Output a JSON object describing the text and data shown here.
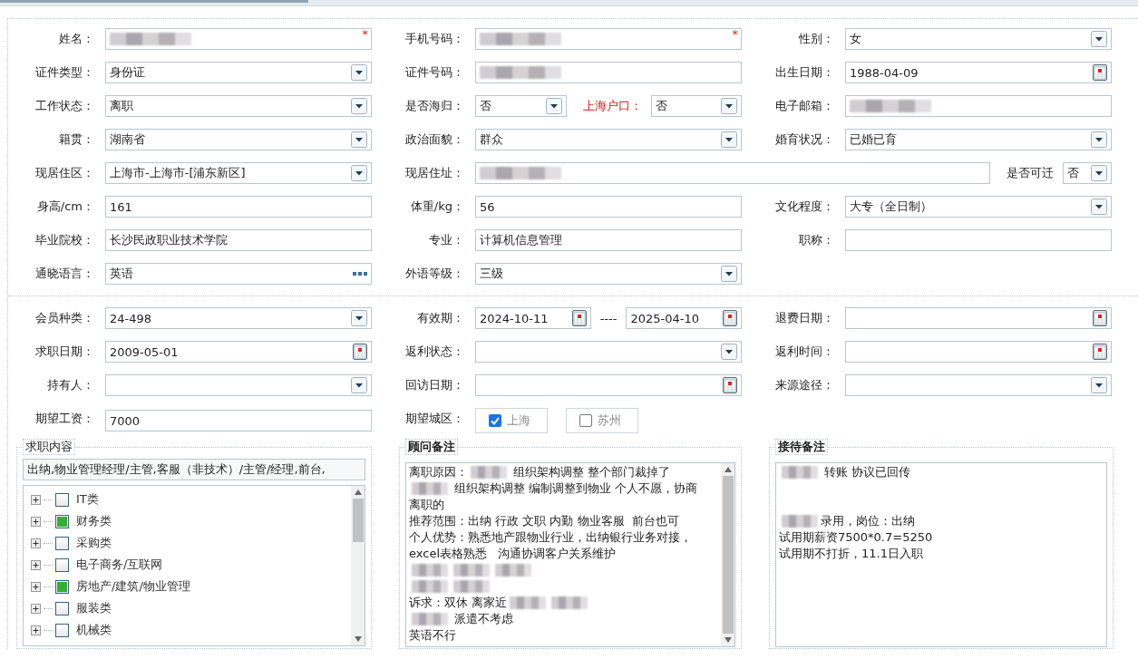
{
  "sections": [
    {
      "rows": [
        {
          "cells": [
            {
              "label": "姓名：",
              "fields": [
                {
                  "kind": "text",
                  "redacted": true,
                  "marker": "*"
                }
              ]
            },
            {
              "label": "手机号码：",
              "fields": [
                {
                  "kind": "text",
                  "redacted": true,
                  "marker": "*"
                }
              ]
            },
            {
              "label": "性别：",
              "fields": [
                {
                  "kind": "select",
                  "value": "女"
                }
              ]
            }
          ]
        },
        {
          "cells": [
            {
              "label": "证件类型：",
              "fields": [
                {
                  "kind": "select",
                  "value": "身份证"
                }
              ]
            },
            {
              "label": "证件号码：",
              "fields": [
                {
                  "kind": "text",
                  "redacted": true
                }
              ]
            },
            {
              "label": "出生日期：",
              "fields": [
                {
                  "kind": "date",
                  "value": "1988-04-09"
                }
              ]
            }
          ]
        },
        {
          "cells": [
            {
              "label": "工作状态：",
              "fields": [
                {
                  "kind": "select",
                  "value": "离职"
                }
              ]
            },
            {
              "label": "是否海归：",
              "fields": [
                {
                  "kind": "select",
                  "value": "否"
                },
                {
                  "kind": "select",
                  "label": "上海户口：",
                  "label_emphasis": true,
                  "value": "否"
                }
              ]
            },
            {
              "label": "电子邮箱：",
              "fields": [
                {
                  "kind": "text",
                  "redacted": true
                }
              ]
            }
          ]
        },
        {
          "cells": [
            {
              "label": "籍贯：",
              "fields": [
                {
                  "kind": "select",
                  "value": "湖南省"
                }
              ]
            },
            {
              "label": "政治面貌：",
              "fields": [
                {
                  "kind": "select",
                  "value": "群众"
                }
              ]
            },
            {
              "label": "婚育状况：",
              "fields": [
                {
                  "kind": "select",
                  "value": "已婚已育"
                }
              ]
            }
          ]
        },
        {
          "cells": [
            {
              "label": "现居住区：",
              "fields": [
                {
                  "kind": "select",
                  "value": "上海市-上海市-[浦东新区]"
                }
              ]
            },
            {
              "label": "现居住址：",
              "kind": "wide",
              "fields": [
                {
                  "kind": "text",
                  "redacted": true
                },
                {
                  "kind": "select",
                  "label": "是否可迁",
                  "value": "否"
                }
              ]
            }
          ]
        },
        {
          "cells": [
            {
              "label": "身高/cm：",
              "fields": [
                {
                  "kind": "text",
                  "value": "161"
                }
              ]
            },
            {
              "label": "体重/kg：",
              "fields": [
                {
                  "kind": "text",
                  "value": "56"
                }
              ]
            },
            {
              "label": "文化程度：",
              "fields": [
                {
                  "kind": "select",
                  "value": "大专（全日制）"
                }
              ]
            }
          ]
        },
        {
          "cells": [
            {
              "label": "毕业院校：",
              "fields": [
                {
                  "kind": "text",
                  "value": "长沙民政职业技术学院"
                }
              ]
            },
            {
              "label": "专业：",
              "fields": [
                {
                  "kind": "text",
                  "value": "计算机信息管理"
                }
              ]
            },
            {
              "label": "职称：",
              "fields": [
                {
                  "kind": "text"
                }
              ]
            }
          ]
        },
        {
          "cells": [
            {
              "label": "通晓语言：",
              "fields": [
                {
                  "kind": "lookup",
                  "value": "英语"
                }
              ]
            },
            {
              "label": "外语等级：",
              "fields": [
                {
                  "kind": "select",
                  "value": "三级"
                }
              ]
            }
          ]
        }
      ]
    },
    {
      "rows": [
        {
          "cells": [
            {
              "label": "会员种类：",
              "fields": [
                {
                  "kind": "select",
                  "value": "24-498"
                }
              ]
            },
            {
              "label": "有效期：",
              "fields": [
                {
                  "kind": "date-range",
                  "values": [
                    "2024-10-11",
                    "2025-04-10"
                  ],
                  "separator": "----"
                }
              ]
            },
            {
              "label": "退费日期：",
              "fields": [
                {
                  "kind": "date"
                }
              ]
            }
          ]
        },
        {
          "cells": [
            {
              "label": "求职日期：",
              "fields": [
                {
                  "kind": "date",
                  "value": "2009-05-01"
                }
              ]
            },
            {
              "label": "返利状态：",
              "fields": [
                {
                  "kind": "select"
                }
              ]
            },
            {
              "label": "返利时间：",
              "fields": [
                {
                  "kind": "date"
                }
              ]
            }
          ]
        },
        {
          "cells": [
            {
              "label": "持有人：",
              "fields": [
                {
                  "kind": "select"
                }
              ]
            },
            {
              "label": "回访日期：",
              "fields": [
                {
                  "kind": "date"
                }
              ]
            },
            {
              "label": "来源途径：",
              "fields": [
                {
                  "kind": "select"
                }
              ]
            }
          ]
        },
        {
          "cells": [
            {
              "label": "期望工资：",
              "fields": [
                {
                  "kind": "text",
                  "value": "7000"
                }
              ]
            },
            {
              "label": "期望城区：",
              "fields": [
                {
                  "kind": "checkbox-group",
                  "options": [
                    {
                      "label": "上海",
                      "checked": true
                    },
                    {
                      "label": "苏州",
                      "checked": false
                    }
                  ]
                }
              ]
            }
          ]
        }
      ]
    }
  ],
  "job_content": {
    "legend": "求职内容",
    "value": "出纳,物业管理经理/主管,客服（非技术）/主管/经理,前台,",
    "tree": [
      {
        "label": "IT类",
        "checked": false
      },
      {
        "label": "财务类",
        "checked": true
      },
      {
        "label": "采购类",
        "checked": false
      },
      {
        "label": "电子商务/互联网",
        "checked": false
      },
      {
        "label": "房地产/建筑/物业管理",
        "checked": true
      },
      {
        "label": "服装类",
        "checked": false
      },
      {
        "label": "机械类",
        "checked": false
      }
    ]
  },
  "notes": [
    {
      "legend": "顾问备注",
      "scrollbar": true,
      "lines": [
        {
          "segments": [
            {
              "kind": "text",
              "text": "离职原因："
            },
            {
              "kind": "redacted"
            },
            {
              "kind": "text",
              "text": " 组织架构调整 整个部门裁掉了"
            }
          ]
        },
        {
          "segments": [
            {
              "kind": "redacted"
            },
            {
              "kind": "text",
              "text": " 组织架构调整 编制调整到物业 个人不愿，协商"
            }
          ]
        },
        {
          "segments": [
            {
              "kind": "text",
              "text": "离职的"
            }
          ]
        },
        {
          "segments": [
            {
              "kind": "text",
              "text": "推荐范围：出纳 行政 文职 内勤 物业客服  前台也可"
            }
          ]
        },
        {
          "segments": [
            {
              "kind": "text",
              "text": "个人优势：熟悉地产跟物业行业，出纳银行业务对接，"
            }
          ]
        },
        {
          "segments": [
            {
              "kind": "text",
              "text": "excel表格熟悉   沟通协调客户关系维护"
            }
          ]
        },
        {
          "segments": [
            {
              "kind": "redacted"
            },
            {
              "kind": "redacted"
            },
            {
              "kind": "redacted"
            }
          ]
        },
        {
          "segments": [
            {
              "kind": "redacted"
            },
            {
              "kind": "redacted"
            }
          ]
        },
        {
          "segments": [
            {
              "kind": "text",
              "text": "诉求：双休 离家近"
            },
            {
              "kind": "redacted"
            },
            {
              "kind": "redacted"
            }
          ]
        },
        {
          "segments": [
            {
              "kind": "redacted"
            },
            {
              "kind": "text",
              "text": " 派遣不考虑"
            }
          ]
        },
        {
          "segments": [
            {
              "kind": "text",
              "text": "英语不行"
            }
          ]
        }
      ]
    },
    {
      "legend": "接待备注",
      "scrollbar": false,
      "lines": [
        {
          "segments": [
            {
              "kind": "redacted"
            },
            {
              "kind": "text",
              "text": " 转账 协议已回传"
            }
          ]
        },
        {
          "kind": "blank"
        },
        {
          "kind": "blank"
        },
        {
          "segments": [
            {
              "kind": "redacted"
            },
            {
              "kind": "text",
              "text": "录用，岗位：出纳"
            }
          ]
        },
        {
          "segments": [
            {
              "kind": "text",
              "text": "试用期薪资7500*0.7=5250"
            }
          ]
        },
        {
          "segments": [
            {
              "kind": "text",
              "text": "试用期不打折，11.1日入职"
            }
          ]
        }
      ]
    }
  ]
}
